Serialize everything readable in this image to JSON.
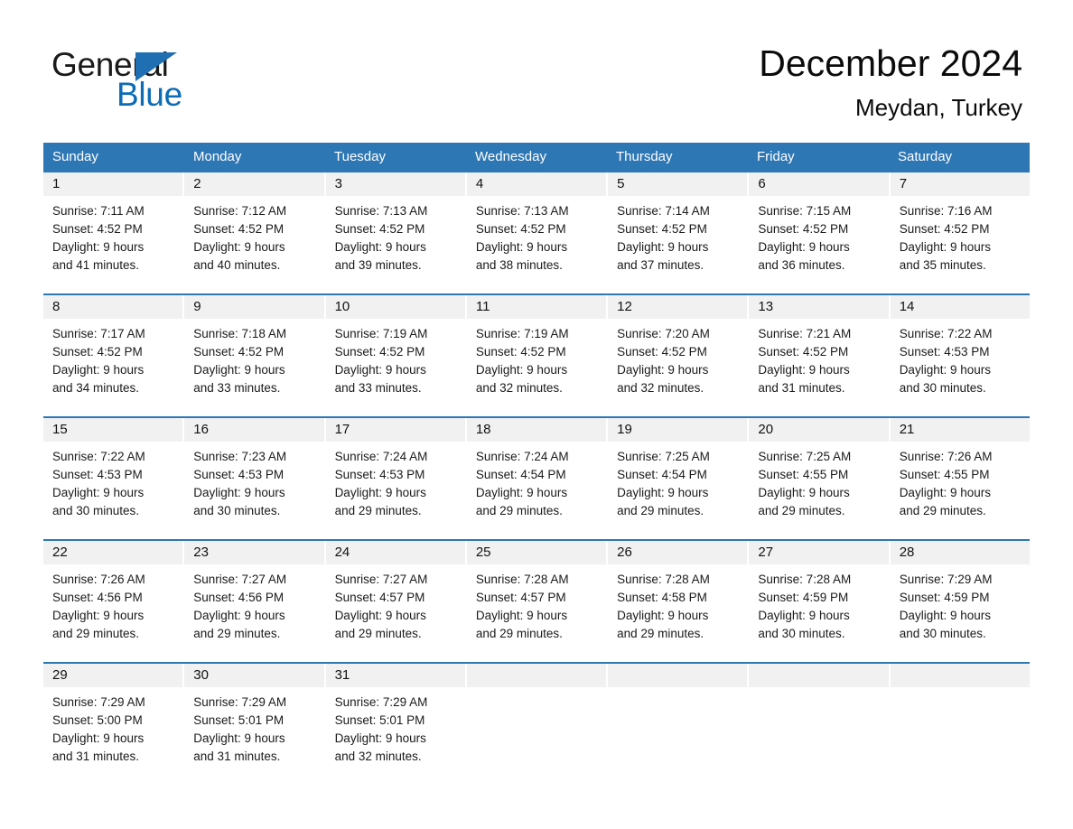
{
  "logo": {
    "word_one": "General",
    "word_two": "Blue",
    "triangle_icon": "triangle-icon",
    "brand_blue": "#0C6CB5",
    "triangle_blue": "#1F6FB2"
  },
  "header": {
    "title": "December 2024",
    "location": "Meydan, Turkey"
  },
  "theme": {
    "header_blue": "#2E77B5",
    "date_band_gray": "#F1F1F1",
    "text_black": "#111111"
  },
  "calendar": {
    "day_headers": [
      "Sunday",
      "Monday",
      "Tuesday",
      "Wednesday",
      "Thursday",
      "Friday",
      "Saturday"
    ],
    "weeks": [
      [
        {
          "date": "1",
          "lines": [
            "Sunrise: 7:11 AM",
            "Sunset: 4:52 PM",
            "Daylight: 9 hours",
            "and 41 minutes."
          ]
        },
        {
          "date": "2",
          "lines": [
            "Sunrise: 7:12 AM",
            "Sunset: 4:52 PM",
            "Daylight: 9 hours",
            "and 40 minutes."
          ]
        },
        {
          "date": "3",
          "lines": [
            "Sunrise: 7:13 AM",
            "Sunset: 4:52 PM",
            "Daylight: 9 hours",
            "and 39 minutes."
          ]
        },
        {
          "date": "4",
          "lines": [
            "Sunrise: 7:13 AM",
            "Sunset: 4:52 PM",
            "Daylight: 9 hours",
            "and 38 minutes."
          ]
        },
        {
          "date": "5",
          "lines": [
            "Sunrise: 7:14 AM",
            "Sunset: 4:52 PM",
            "Daylight: 9 hours",
            "and 37 minutes."
          ]
        },
        {
          "date": "6",
          "lines": [
            "Sunrise: 7:15 AM",
            "Sunset: 4:52 PM",
            "Daylight: 9 hours",
            "and 36 minutes."
          ]
        },
        {
          "date": "7",
          "lines": [
            "Sunrise: 7:16 AM",
            "Sunset: 4:52 PM",
            "Daylight: 9 hours",
            "and 35 minutes."
          ]
        }
      ],
      [
        {
          "date": "8",
          "lines": [
            "Sunrise: 7:17 AM",
            "Sunset: 4:52 PM",
            "Daylight: 9 hours",
            "and 34 minutes."
          ]
        },
        {
          "date": "9",
          "lines": [
            "Sunrise: 7:18 AM",
            "Sunset: 4:52 PM",
            "Daylight: 9 hours",
            "and 33 minutes."
          ]
        },
        {
          "date": "10",
          "lines": [
            "Sunrise: 7:19 AM",
            "Sunset: 4:52 PM",
            "Daylight: 9 hours",
            "and 33 minutes."
          ]
        },
        {
          "date": "11",
          "lines": [
            "Sunrise: 7:19 AM",
            "Sunset: 4:52 PM",
            "Daylight: 9 hours",
            "and 32 minutes."
          ]
        },
        {
          "date": "12",
          "lines": [
            "Sunrise: 7:20 AM",
            "Sunset: 4:52 PM",
            "Daylight: 9 hours",
            "and 32 minutes."
          ]
        },
        {
          "date": "13",
          "lines": [
            "Sunrise: 7:21 AM",
            "Sunset: 4:52 PM",
            "Daylight: 9 hours",
            "and 31 minutes."
          ]
        },
        {
          "date": "14",
          "lines": [
            "Sunrise: 7:22 AM",
            "Sunset: 4:53 PM",
            "Daylight: 9 hours",
            "and 30 minutes."
          ]
        }
      ],
      [
        {
          "date": "15",
          "lines": [
            "Sunrise: 7:22 AM",
            "Sunset: 4:53 PM",
            "Daylight: 9 hours",
            "and 30 minutes."
          ]
        },
        {
          "date": "16",
          "lines": [
            "Sunrise: 7:23 AM",
            "Sunset: 4:53 PM",
            "Daylight: 9 hours",
            "and 30 minutes."
          ]
        },
        {
          "date": "17",
          "lines": [
            "Sunrise: 7:24 AM",
            "Sunset: 4:53 PM",
            "Daylight: 9 hours",
            "and 29 minutes."
          ]
        },
        {
          "date": "18",
          "lines": [
            "Sunrise: 7:24 AM",
            "Sunset: 4:54 PM",
            "Daylight: 9 hours",
            "and 29 minutes."
          ]
        },
        {
          "date": "19",
          "lines": [
            "Sunrise: 7:25 AM",
            "Sunset: 4:54 PM",
            "Daylight: 9 hours",
            "and 29 minutes."
          ]
        },
        {
          "date": "20",
          "lines": [
            "Sunrise: 7:25 AM",
            "Sunset: 4:55 PM",
            "Daylight: 9 hours",
            "and 29 minutes."
          ]
        },
        {
          "date": "21",
          "lines": [
            "Sunrise: 7:26 AM",
            "Sunset: 4:55 PM",
            "Daylight: 9 hours",
            "and 29 minutes."
          ]
        }
      ],
      [
        {
          "date": "22",
          "lines": [
            "Sunrise: 7:26 AM",
            "Sunset: 4:56 PM",
            "Daylight: 9 hours",
            "and 29 minutes."
          ]
        },
        {
          "date": "23",
          "lines": [
            "Sunrise: 7:27 AM",
            "Sunset: 4:56 PM",
            "Daylight: 9 hours",
            "and 29 minutes."
          ]
        },
        {
          "date": "24",
          "lines": [
            "Sunrise: 7:27 AM",
            "Sunset: 4:57 PM",
            "Daylight: 9 hours",
            "and 29 minutes."
          ]
        },
        {
          "date": "25",
          "lines": [
            "Sunrise: 7:28 AM",
            "Sunset: 4:57 PM",
            "Daylight: 9 hours",
            "and 29 minutes."
          ]
        },
        {
          "date": "26",
          "lines": [
            "Sunrise: 7:28 AM",
            "Sunset: 4:58 PM",
            "Daylight: 9 hours",
            "and 29 minutes."
          ]
        },
        {
          "date": "27",
          "lines": [
            "Sunrise: 7:28 AM",
            "Sunset: 4:59 PM",
            "Daylight: 9 hours",
            "and 30 minutes."
          ]
        },
        {
          "date": "28",
          "lines": [
            "Sunrise: 7:29 AM",
            "Sunset: 4:59 PM",
            "Daylight: 9 hours",
            "and 30 minutes."
          ]
        }
      ],
      [
        {
          "date": "29",
          "lines": [
            "Sunrise: 7:29 AM",
            "Sunset: 5:00 PM",
            "Daylight: 9 hours",
            "and 31 minutes."
          ]
        },
        {
          "date": "30",
          "lines": [
            "Sunrise: 7:29 AM",
            "Sunset: 5:01 PM",
            "Daylight: 9 hours",
            "and 31 minutes."
          ]
        },
        {
          "date": "31",
          "lines": [
            "Sunrise: 7:29 AM",
            "Sunset: 5:01 PM",
            "Daylight: 9 hours",
            "and 32 minutes."
          ]
        },
        {
          "date": "",
          "lines": []
        },
        {
          "date": "",
          "lines": []
        },
        {
          "date": "",
          "lines": []
        },
        {
          "date": "",
          "lines": []
        }
      ]
    ]
  }
}
